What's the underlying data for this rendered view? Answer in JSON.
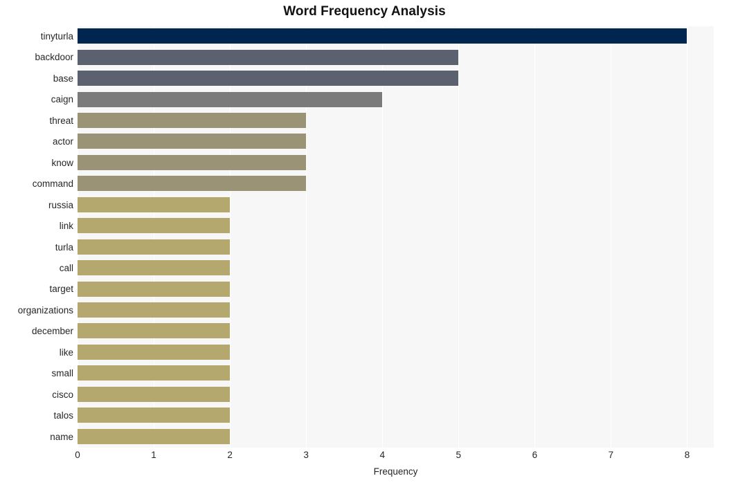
{
  "chart_data": {
    "type": "bar",
    "orientation": "horizontal",
    "title": "Word Frequency Analysis",
    "xlabel": "Frequency",
    "ylabel": "",
    "xlim": [
      0,
      8.35
    ],
    "ylim": [
      0,
      20
    ],
    "grid": true,
    "gridlines": "vertical-white",
    "legend": "none",
    "xticks": [
      0,
      1,
      2,
      3,
      4,
      5,
      6,
      7,
      8
    ],
    "xtick_labels": [
      "0",
      "1",
      "2",
      "3",
      "4",
      "5",
      "6",
      "7",
      "8"
    ],
    "categories": [
      "tinyturla",
      "backdoor",
      "base",
      "caign",
      "threat",
      "actor",
      "know",
      "command",
      "russia",
      "link",
      "turla",
      "call",
      "target",
      "organizations",
      "december",
      "like",
      "small",
      "cisco",
      "talos",
      "name"
    ],
    "values": [
      8,
      5,
      5,
      4,
      3,
      3,
      3,
      3,
      2,
      2,
      2,
      2,
      2,
      2,
      2,
      2,
      2,
      2,
      2,
      2
    ],
    "bar_colors": [
      "#00264f",
      "#5c6170",
      "#5c6170",
      "#7b7b7b",
      "#9a9375",
      "#9a9375",
      "#9a9375",
      "#9a9375",
      "#b5a86e",
      "#b5a86e",
      "#b5a86e",
      "#b5a86e",
      "#b5a86e",
      "#b5a86e",
      "#b5a86e",
      "#b5a86e",
      "#b5a86e",
      "#b5a86e",
      "#b5a86e",
      "#b5a86e"
    ],
    "plot_background": "#f7f7f7",
    "figure_background": "#ffffff",
    "title_color": "#111111",
    "tick_color": "#262626"
  }
}
